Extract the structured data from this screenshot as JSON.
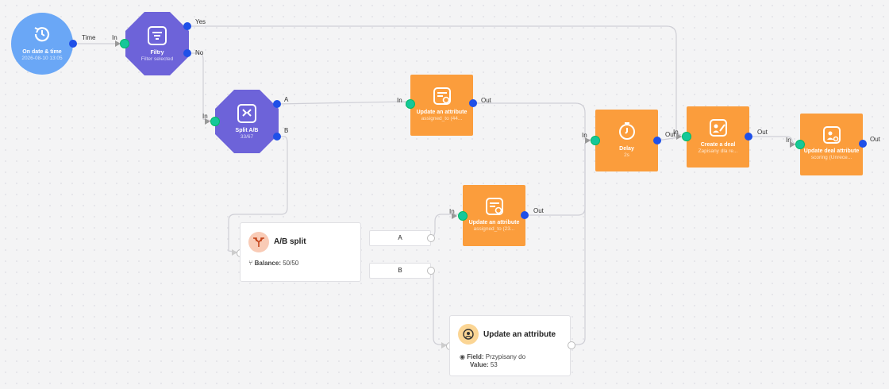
{
  "nodes": {
    "trigger": {
      "title": "On date & time",
      "subtitle": "2026-08-10 13:05",
      "out_label": "Time",
      "icon": "clock-history-icon"
    },
    "filter": {
      "title": "Filtry",
      "subtitle": "Filter selected",
      "in_label": "In",
      "yes_label": "Yes",
      "no_label": "No",
      "icon": "filter-icon"
    },
    "split": {
      "title": "Split A/B",
      "subtitle": "33/67",
      "in_label": "In",
      "a_label": "A",
      "b_label": "B",
      "icon": "split-icon"
    },
    "update1": {
      "title": "Update an attribute",
      "subtitle": "assigned_to (44...",
      "in_label": "In",
      "out_label": "Out",
      "icon": "edit-doc-icon"
    },
    "update2": {
      "title": "Update an attribute",
      "subtitle": "assigned_to (23...",
      "in_label": "In",
      "out_label": "Out",
      "icon": "edit-doc-icon"
    },
    "delay": {
      "title": "Delay",
      "subtitle": "2s",
      "in_label": "In",
      "out_label": "Out",
      "icon": "timer-icon"
    },
    "deal": {
      "title": "Create a deal",
      "subtitle": "Zapisany dla re...",
      "in_label": "In",
      "out_label": "Out",
      "icon": "people-edit-icon"
    },
    "deal_attr": {
      "title": "Update deal attribute",
      "subtitle": "scoring (Unrece...",
      "in_label": "In",
      "out_label": "Out",
      "icon": "people-doc-icon"
    }
  },
  "ab_card": {
    "title": "A/B split",
    "balance_label": "Balance:",
    "balance_value": "50/50",
    "branch_a": "A",
    "branch_b": "B"
  },
  "update_card": {
    "title": "Update an attribute",
    "field_label": "Field:",
    "field_value": "Przypisany do",
    "value_label": "Value:",
    "value_value": "53"
  },
  "colors": {
    "trigger": "#6aa7f6",
    "filter": "#6d63d9",
    "action": "#fb9d3c",
    "port_out": "#1f50e8",
    "port_in": "#16c79a"
  }
}
